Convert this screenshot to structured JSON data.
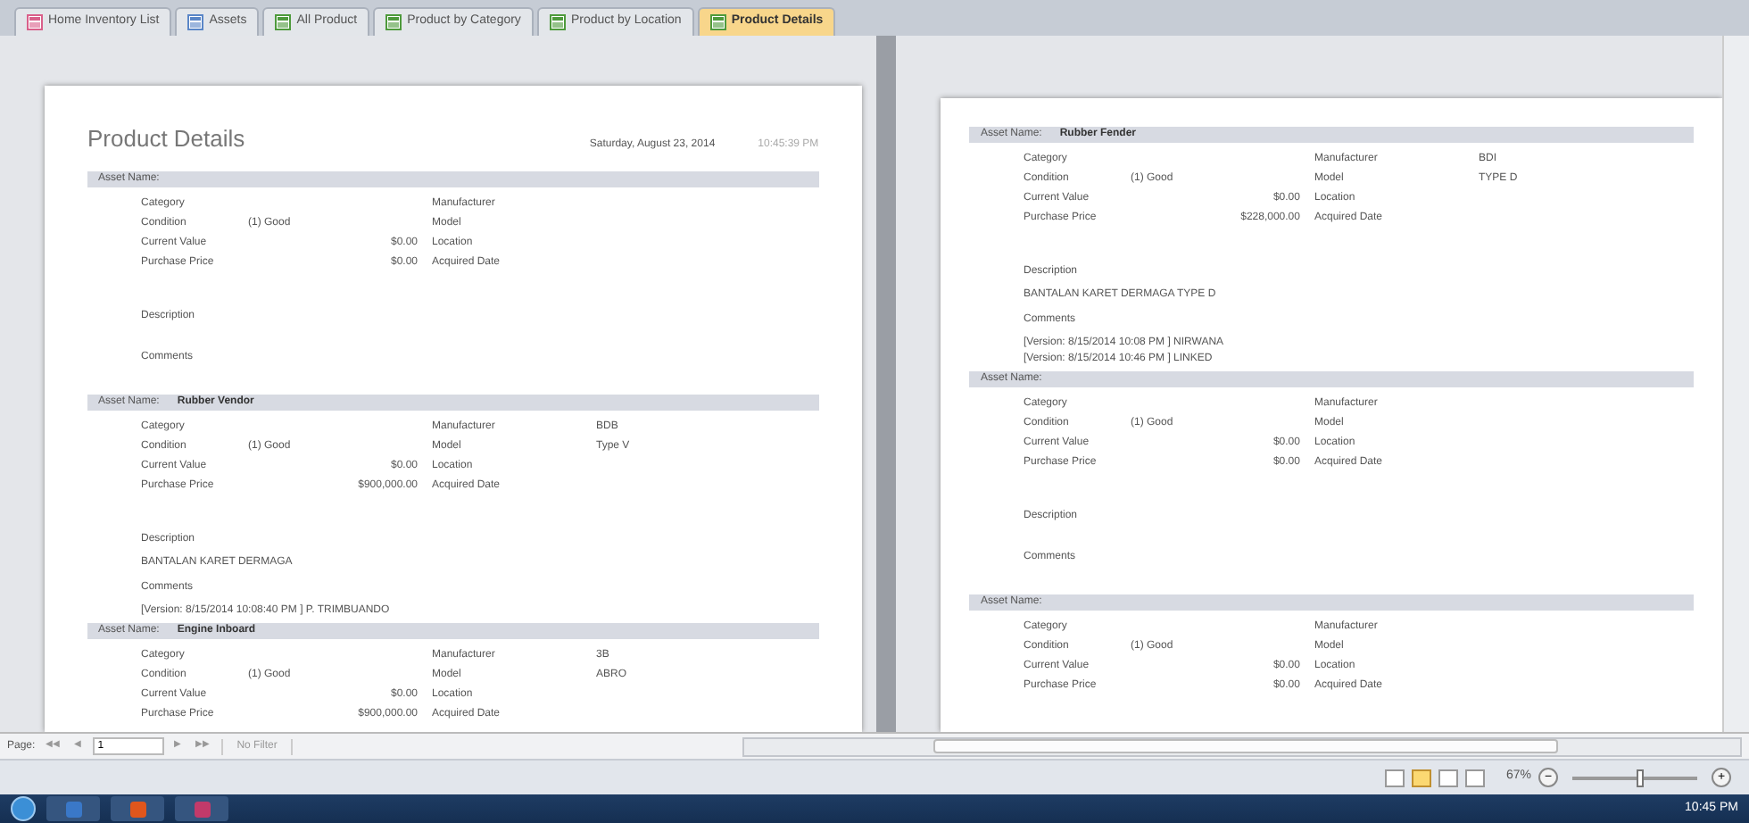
{
  "tabs": [
    {
      "label": "Home Inventory List",
      "kind": "form",
      "selected": false
    },
    {
      "label": "Assets",
      "kind": "table",
      "selected": false
    },
    {
      "label": "All Product",
      "kind": "report",
      "selected": false
    },
    {
      "label": "Product by Category",
      "kind": "report",
      "selected": false
    },
    {
      "label": "Product by Location",
      "kind": "report",
      "selected": false
    },
    {
      "label": "Product Details",
      "kind": "report",
      "selected": true
    }
  ],
  "pages": [
    {
      "title": "Product Details",
      "date": "Saturday, August 23, 2014",
      "time": "10:45:39 PM",
      "records": [
        {
          "name_label": "Asset Name:",
          "left": [
            {
              "label": "Category"
            },
            {
              "label": "Condition",
              "value": "(1) Good",
              "kind": "text"
            },
            {
              "label": "Current Value",
              "value": "$0.00",
              "kind": "money"
            },
            {
              "label": "Purchase Price",
              "value": "$0.00",
              "kind": "money"
            }
          ],
          "right": [
            {
              "label": "Manufacturer"
            },
            {
              "label": "Model"
            },
            {
              "label": "Location"
            },
            {
              "label": "Acquired Date"
            }
          ],
          "description_label": "Description",
          "comments_label": "Comments"
        },
        {
          "name_label": "Asset Name:",
          "name": "Rubber Vendor",
          "left": [
            {
              "label": "Category"
            },
            {
              "label": "Condition",
              "value": "(1) Good",
              "kind": "text"
            },
            {
              "label": "Current Value",
              "value": "$0.00",
              "kind": "money"
            },
            {
              "label": "Purchase Price",
              "value": "$900,000.00",
              "kind": "money"
            }
          ],
          "right": [
            {
              "label": "Manufacturer",
              "value": "BDB"
            },
            {
              "label": "Model",
              "value": "Type V"
            },
            {
              "label": "Location"
            },
            {
              "label": "Acquired Date"
            }
          ],
          "description_label": "Description",
          "description": "BANTALAN KARET DERMAGA",
          "comments_label": "Comments",
          "comments": [
            "[Version: 8/15/2014 10:08:40 PM ] P. TRIMBUANDO"
          ]
        },
        {
          "name_label": "Asset Name:",
          "name": "Engine Inboard",
          "left": [
            {
              "label": "Category"
            },
            {
              "label": "Condition",
              "value": "(1) Good",
              "kind": "text"
            },
            {
              "label": "Current Value",
              "value": "$0.00",
              "kind": "money"
            },
            {
              "label": "Purchase Price",
              "value": "$900,000.00",
              "kind": "money"
            }
          ],
          "right": [
            {
              "label": "Manufacturer",
              "value": "3B"
            },
            {
              "label": "Model",
              "value": "ABRO"
            },
            {
              "label": "Location"
            },
            {
              "label": "Acquired Date"
            }
          ]
        }
      ]
    },
    {
      "records": [
        {
          "name_label": "Asset Name:",
          "name": "Rubber Fender",
          "left": [
            {
              "label": "Category"
            },
            {
              "label": "Condition",
              "value": "(1) Good",
              "kind": "text"
            },
            {
              "label": "Current Value",
              "value": "$0.00",
              "kind": "money"
            },
            {
              "label": "Purchase Price",
              "value": "$228,000.00",
              "kind": "money"
            }
          ],
          "right": [
            {
              "label": "Manufacturer",
              "value": "BDI"
            },
            {
              "label": "Model",
              "value": "TYPE D"
            },
            {
              "label": "Location"
            },
            {
              "label": "Acquired Date"
            }
          ],
          "description_label": "Description",
          "description": "BANTALAN KARET DERMAGA TYPE D",
          "comments_label": "Comments",
          "comments": [
            "[Version: 8/15/2014 10:08 PM ] NIRWANA",
            "[Version: 8/15/2014 10:46 PM ] LINKED"
          ]
        },
        {
          "name_label": "Asset Name:",
          "left": [
            {
              "label": "Category"
            },
            {
              "label": "Condition",
              "value": "(1) Good",
              "kind": "text"
            },
            {
              "label": "Current Value",
              "value": "$0.00",
              "kind": "money"
            },
            {
              "label": "Purchase Price",
              "value": "$0.00",
              "kind": "money"
            }
          ],
          "right": [
            {
              "label": "Manufacturer"
            },
            {
              "label": "Model"
            },
            {
              "label": "Location"
            },
            {
              "label": "Acquired Date"
            }
          ],
          "description_label": "Description",
          "comments_label": "Comments"
        },
        {
          "name_label": "Asset Name:",
          "left": [
            {
              "label": "Category"
            },
            {
              "label": "Condition",
              "value": "(1) Good",
              "kind": "text"
            },
            {
              "label": "Current Value",
              "value": "$0.00",
              "kind": "money"
            },
            {
              "label": "Purchase Price",
              "value": "$0.00",
              "kind": "money"
            }
          ],
          "right": [
            {
              "label": "Manufacturer"
            },
            {
              "label": "Model"
            },
            {
              "label": "Location"
            },
            {
              "label": "Acquired Date"
            }
          ]
        }
      ]
    }
  ],
  "navigation": {
    "label": "Page:",
    "first": "◀◀",
    "prev": "◀",
    "page": "1",
    "next": "▶",
    "last": "▶▶",
    "filter": "No Filter"
  },
  "status_bar": {
    "zoom": "67%",
    "minus": "−",
    "plus": "+",
    "level": 0.55,
    "views": [
      {
        "selected": false
      },
      {
        "selected": true
      },
      {
        "selected": false
      },
      {
        "selected": false
      }
    ]
  },
  "taskbar": {
    "clock": "10:45 PM",
    "apps": [
      {
        "color": "#3a78c8"
      },
      {
        "color": "#e0561c"
      },
      {
        "color": "#c23a6a"
      }
    ]
  }
}
